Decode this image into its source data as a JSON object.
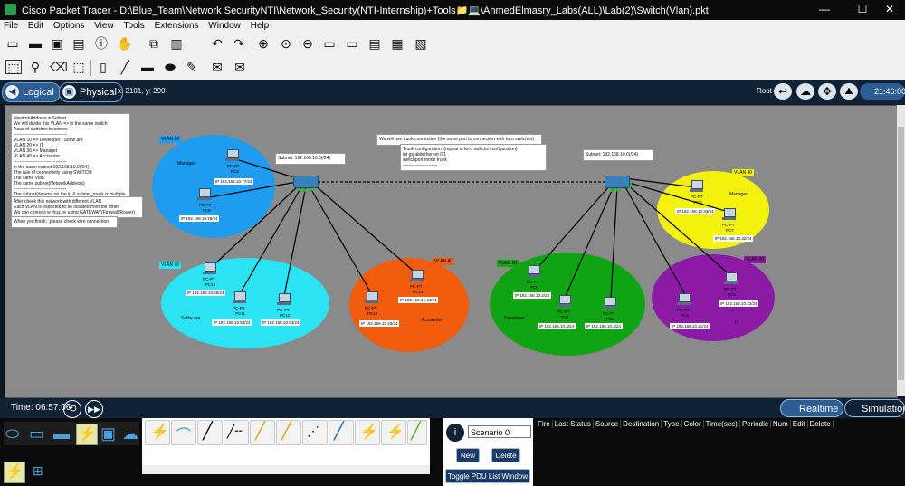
{
  "window": {
    "title": "Cisco Packet Tracer - D:\\Blue_Team\\Network SecurityNTI\\Network_Security(NTI-Internship)+Tools📁💻\\AhmedElmasry_Labs(ALL)\\Lab(2)\\Switch(Vlan).pkt",
    "minimize": "—",
    "maximize": "☐",
    "close": "✕"
  },
  "menu": [
    "File",
    "Edit",
    "Options",
    "View",
    "Tools",
    "Extensions",
    "Window",
    "Help"
  ],
  "nav": {
    "logical": "Logical",
    "physical": "Physical",
    "coords": "x: 2101, y: 290",
    "root": "Root",
    "clock": "21:46:00"
  },
  "notes": {
    "main": "NewtorkAddress = Subnet\nWe will divide this VLAN => in the same switch\nAaaa of switches becomes\n-----------------------------------\nVLAN 10 => Developer / Softw are\nVLAN 20 => IT\nVLAN 30 => Manager\nVLAN 40 => Accounter\n-----------------------------------\nin the same subnet 192.168.10.0(/24)\nThe rule of connectivity using SWITCH:\nThe same Vlan\nThe same subnet(NetworkAddress)\n-----------------------------------\nThe subnet(depend on the ip & subnet_mask is multiple\n-----------------------------------",
    "routing": "After check this network with different VLAN\nEach VLAN is expected to be isolated from the other\nWe can connect w thus by using GATEWAY(Firewall/Router)",
    "finish": "When you finish: ,please check wire connection",
    "trunk_title": "We will use trunk connection (the same port to connection with tw o switches)",
    "trunk_cfg": "Trunk configuration: (repeat in tw o switchs configuration)\nint gigabitethernet 0/1\nswitchport mode trunk\n-----------------------",
    "subnet_left": "Subnet: 192.168.10.0(/24)",
    "subnet_right": "Subnet: 192.168.10.0(/24)"
  },
  "zones": {
    "vlan30_left": {
      "tag": "VLAN 30",
      "name": "Manager",
      "color": "#1e9cf0"
    },
    "vlan10_left": {
      "tag": "VLAN 10",
      "name": "Softw are",
      "color": "#2be3f2"
    },
    "vlan40": {
      "tag": "VLAN 40",
      "name": "Accounter",
      "color": "#f25c0c"
    },
    "vlan10_right": {
      "tag": "VLAN 10",
      "name": "Developer",
      "color": "#0ea312"
    },
    "vlan30_right": {
      "tag": "VLAN 30",
      "name": "Manager",
      "color": "#f2f20c"
    },
    "vlan20": {
      "tag": "VLAN 20",
      "name": "IT",
      "color": "#8b1aa6"
    }
  },
  "hosts": {
    "pc8": {
      "type": "PC-PT",
      "name": "PC8",
      "ip": "IP 192.168.10.77/24"
    },
    "pc9": {
      "type": "PC-PT",
      "name": "PC9",
      "ip": "IP 192.168.10.78/24"
    },
    "pc10": {
      "type": "PC-PT",
      "name": "PC10",
      "ip": "IP 192.168.10.55/24"
    },
    "pc11": {
      "type": "PC-PT",
      "name": "PC11",
      "ip": "IP 192.168.10.54/24"
    },
    "pc12": {
      "type": "PC-PT",
      "name": "PC12",
      "ip": "IP 192.168.10.53/24"
    },
    "pc13": {
      "type": "PC-PT",
      "name": "PC13",
      "ip": "IP 192.168.10.43/24"
    },
    "pc14": {
      "type": "PC-PT",
      "name": "PC14",
      "ip": "IP 192.168.10.44/24"
    },
    "pc0": {
      "type": "PC-PT",
      "name": "PC0",
      "ip": "IP 192.168.10.2/24"
    },
    "pc1": {
      "type": "PC-PT",
      "name": "PC1",
      "ip": "IP 192.168.10.3/24"
    },
    "pc2": {
      "type": "PC-PT",
      "name": "PC2",
      "ip": "IP 192.168.10.4/24"
    },
    "pc6": {
      "type": "PC-PT",
      "name": "PC6",
      "ip": "IP 192.168.10.33/24"
    },
    "pc7": {
      "type": "PC-PT",
      "name": "PC7",
      "ip": "IP 192.168.10.32/24"
    },
    "pc4": {
      "type": "PC-PT",
      "name": "PC4",
      "ip": "IP 192.168.10.21/24"
    },
    "pc5": {
      "type": "PC-PT",
      "name": "PC5",
      "ip": "IP 192.168.10.22/24"
    }
  },
  "bottom": {
    "time": "Time: 06:57:06",
    "realtime": "Realtime",
    "simulation": "Simulation",
    "scenario": "Scenario 0",
    "new": "New",
    "delete": "Delete",
    "toggle": "Toggle PDU List Window",
    "pdu_columns": [
      "Fire",
      "Last Status",
      "Source",
      "Destination",
      "Type",
      "Color",
      "Time(sec)",
      "Periodic",
      "Num",
      "Edit",
      "Delete"
    ]
  },
  "icons": [
    "new-icon",
    "open-icon",
    "save-icon",
    "print-icon",
    "info-icon",
    "wizard-icon",
    "copy-icon",
    "paste-icon",
    "undo-icon",
    "redo-icon",
    "zoom-in-icon",
    "zoom-reset-icon",
    "zoom-out-icon",
    "palette-icon",
    "custom-icon",
    "list-icon",
    "image-icon",
    "select-icon",
    "inspect-icon",
    "delete-icon",
    "resize-icon",
    "note-icon",
    "line-icon",
    "rect-icon",
    "ellipse-icon",
    "freeform-icon",
    "pdu-simple-icon",
    "pdu-complex-icon"
  ]
}
